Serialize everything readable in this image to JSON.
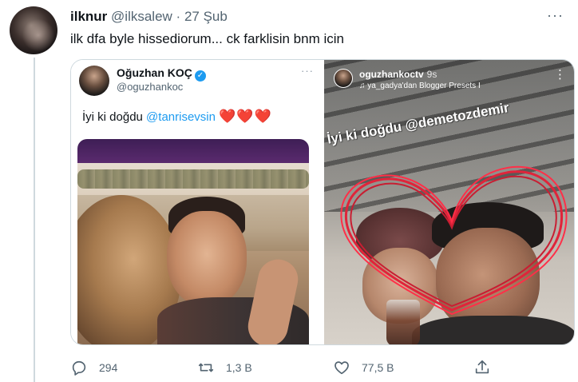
{
  "tweet": {
    "author_name": "ilknur",
    "author_handle": "@ilksalew",
    "separator": "·",
    "date": "27 Şub",
    "more": "···",
    "text": "ilk dfa byle hissediorum... ck farklisin bnm icin"
  },
  "left_screenshot": {
    "name": "Oğuzhan KOÇ",
    "verified_mark": "✓",
    "handle": "@oguzhankoc",
    "more": "···",
    "text_prefix": "İyi ki doğdu ",
    "mention": "@tanrisevsin",
    "hearts": "❤️❤️❤️"
  },
  "right_story": {
    "username": "oguzhankoctv",
    "time": "9s",
    "music": "♫ ya_gadya'dan Blogger Presets I",
    "more": "⋮",
    "caption": "İyi ki doğdu @demetozdemir"
  },
  "actions": {
    "reply_count": "294",
    "retweet_count": "1,3 B",
    "like_count": "77,5 B"
  },
  "colors": {
    "accent": "#1d9bf0",
    "text": "#0f1419",
    "secondary": "#536471",
    "heart": "#e0243a",
    "border": "#cfd9de"
  },
  "icons": [
    "reply-icon",
    "retweet-icon",
    "like-icon",
    "share-icon",
    "verified-icon",
    "more-icon"
  ]
}
